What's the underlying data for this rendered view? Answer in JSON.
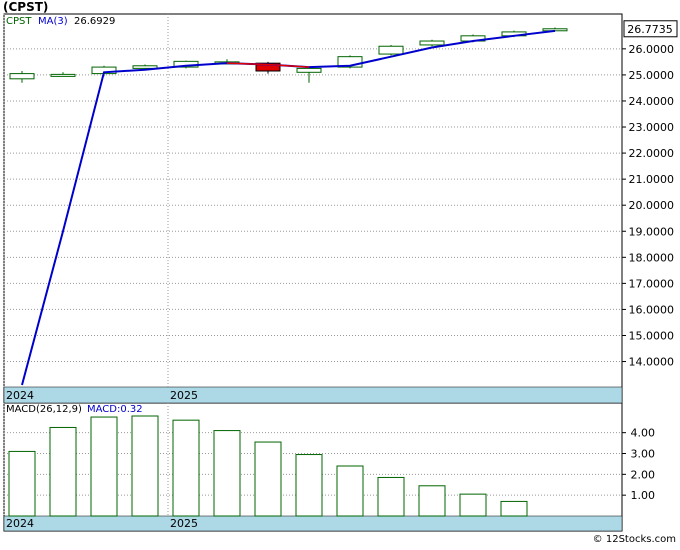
{
  "header": {
    "title": "(CPST)"
  },
  "legend": {
    "symbol": "CPST",
    "ma_label": "MA(3)",
    "ma_value": "26.6929"
  },
  "last_price_label": "26.7735",
  "macd_legend": {
    "label": "MACD(26,12,9)",
    "value_label": "MACD:0.32"
  },
  "watermark": "© 12Stocks.com",
  "colors": {
    "up": "#006400",
    "down": "#e00000",
    "ma_line": "#0000cc",
    "band": "#add8e6",
    "grid": "#999999"
  },
  "chart_data": [
    {
      "type": "candlestick",
      "title": "",
      "yticks": [
        "14.0000",
        "15.0000",
        "16.0000",
        "17.0000",
        "18.0000",
        "19.0000",
        "20.0000",
        "21.0000",
        "22.0000",
        "23.0000",
        "24.0000",
        "25.0000",
        "26.0000"
      ],
      "ylim": [
        13.1,
        26.8
      ],
      "year_labels": [
        {
          "label": "2024",
          "index": 0
        },
        {
          "label": "2025",
          "index": 4
        }
      ],
      "candles": [
        {
          "open": 24.85,
          "close": 25.05,
          "high": 25.15,
          "low": 24.7
        },
        {
          "open": 25.0,
          "close": 25.02,
          "high": 25.1,
          "low": 24.95
        },
        {
          "open": 25.05,
          "close": 25.3,
          "high": 25.35,
          "low": 24.95
        },
        {
          "open": 25.25,
          "close": 25.35,
          "high": 25.4,
          "low": 25.2
        },
        {
          "open": 25.3,
          "close": 25.52,
          "high": 25.55,
          "low": 25.25
        },
        {
          "open": 25.45,
          "close": 25.5,
          "high": 25.6,
          "low": 25.4
        },
        {
          "open": 25.45,
          "close": 25.15,
          "high": 25.5,
          "low": 25.05
        },
        {
          "open": 25.1,
          "close": 25.25,
          "high": 25.3,
          "low": 24.7
        },
        {
          "open": 25.3,
          "close": 25.7,
          "high": 25.75,
          "low": 25.25
        },
        {
          "open": 25.8,
          "close": 26.1,
          "high": 26.15,
          "low": 25.75
        },
        {
          "open": 26.15,
          "close": 26.3,
          "high": 26.35,
          "low": 26.1
        },
        {
          "open": 26.3,
          "close": 26.5,
          "high": 26.55,
          "low": 26.25
        },
        {
          "open": 26.5,
          "close": 26.65,
          "high": 26.7,
          "low": 26.45
        },
        {
          "open": 26.7,
          "close": 26.77,
          "high": 26.82,
          "low": 26.68
        }
      ],
      "ma_series": {
        "x": [
          0,
          1,
          2,
          3,
          4,
          5,
          6,
          7,
          8,
          9,
          10,
          11,
          12,
          13
        ],
        "values": [
          13.1,
          19.0,
          25.1,
          25.2,
          25.35,
          25.45,
          25.4,
          25.3,
          25.35,
          25.7,
          26.05,
          26.3,
          26.5,
          26.69
        ]
      }
    },
    {
      "type": "bar",
      "title": "",
      "yticks": [
        "1.00",
        "2.00",
        "3.00",
        "4.00"
      ],
      "ylim": [
        0,
        4.8
      ],
      "year_labels": [
        {
          "label": "2024",
          "index": 0
        },
        {
          "label": "2025",
          "index": 4
        }
      ],
      "values": [
        3.1,
        4.25,
        4.75,
        4.8,
        4.6,
        4.1,
        3.55,
        2.95,
        2.4,
        1.85,
        1.45,
        1.05,
        0.7
      ]
    }
  ]
}
